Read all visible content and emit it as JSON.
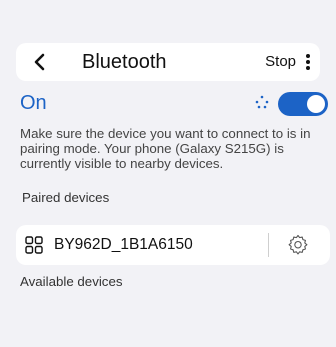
{
  "header": {
    "title": "Bluetooth",
    "stop_label": "Stop",
    "back_icon": "chevron-left-icon",
    "more_icon": "more-vertical-icon"
  },
  "status": {
    "state_label": "On",
    "toggle_on": true,
    "accent_color": "#1c63c6"
  },
  "description": "Make sure the device you want to connect to is in pairing mode. Your phone (Galaxy S215G) is currently visible to nearby devices.",
  "paired": {
    "section_label": "Paired devices",
    "devices": [
      {
        "name": "BY962D_1B1A6150",
        "icon": "device-icon",
        "settings_icon": "gear-icon"
      }
    ]
  },
  "available": {
    "section_label": "Available devices"
  }
}
